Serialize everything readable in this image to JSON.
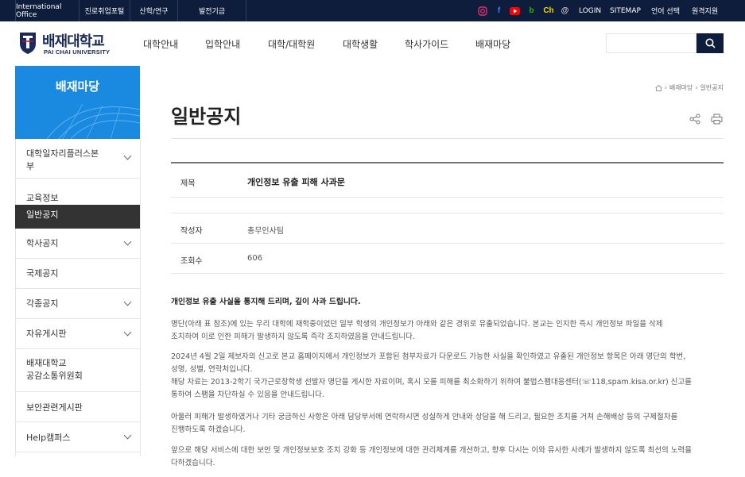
{
  "topbar": {
    "left_links": [
      "International Office",
      "진로취업포털",
      "산학/연구",
      "발전기금"
    ],
    "right_links": [
      "LOGIN",
      "SITEMAP",
      "언어 선택",
      "원격지원"
    ],
    "social": [
      {
        "name": "instagram-icon",
        "color": "#e1306c"
      },
      {
        "name": "facebook-icon",
        "glyph": "f",
        "color": "#3b82f6"
      },
      {
        "name": "youtube-icon",
        "color": "#ff0000"
      },
      {
        "name": "blog-icon",
        "glyph": "b",
        "color": "#2db400"
      },
      {
        "name": "channel-icon",
        "glyph": "Ch",
        "color": "#f2d600"
      },
      {
        "name": "threads-icon",
        "glyph": "@",
        "color": "#cccccc"
      }
    ]
  },
  "header": {
    "logo_kr": "배재대학교",
    "logo_en": "PAI CHAI UNIVERSITY",
    "nav": [
      "대학안내",
      "입학안내",
      "대학/대학원",
      "대학생활",
      "학사가이드",
      "배재마당"
    ],
    "search_placeholder": ""
  },
  "sidebar": {
    "title": "배재마당",
    "items": [
      {
        "label_lines": [
          "대학일자리플러스본",
          "부"
        ],
        "chevron": true
      },
      {
        "label_lines": [
          "교육정보"
        ],
        "chevron": false
      },
      {
        "label_lines": [
          "일반공지"
        ],
        "active": true
      },
      {
        "label_lines": [
          "학사공지"
        ],
        "chevron": true
      },
      {
        "label_lines": [
          "국제공지"
        ],
        "chevron": false
      },
      {
        "label_lines": [
          "각종공지"
        ],
        "chevron": true
      },
      {
        "label_lines": [
          "자유게시판"
        ],
        "chevron": true
      },
      {
        "label_lines": [
          "배재대학교",
          "공감소통위원회"
        ],
        "chevron": false
      },
      {
        "label_lines": [
          "보안관련게시판"
        ],
        "chevron": false
      },
      {
        "label_lines": [
          "Help캠퍼스"
        ],
        "chevron": true
      }
    ]
  },
  "breadcrumb": [
    "배재마당",
    "일반공지"
  ],
  "page_title": "일반공지",
  "post": {
    "title_label": "제목",
    "title": "개인정보 유출 피해 사과문",
    "author_label": "작성자",
    "author": "총무인사팀",
    "views_label": "조회수",
    "views": "606"
  },
  "body": {
    "lead": "개인정보 유출 사실을 통지해 드리며, 깊이 사과 드립니다.",
    "p1": [
      "명단(아래 표 참조)에 있는 우리 대학에 재학중이었던 일부 학생의 개인정보가 아래와 같은 경위로 유출되었습니다. 본교는 인지한 즉시 개인정보 파일을 삭제",
      "조치하여 이로 인한 피해가 발생하지 않도록 즉각 조치하였음을 안내드립니다."
    ],
    "p2": [
      "2024년 4월 2일 제보자의 신고로 본교 홈페이지에서 개인정보가 포함된 첨부자료가 다운로드 가능한 사실을 확인하였고 유출된 개인정보 항목은 아래 명단의 학번,",
      "성명, 성별, 연락처입니다.",
      "해당 자료는 2013-2학기 국가근로장학생 선발자 명단을 게시한 자료이며, 혹시 모를 피해를 최소화하기 위하여 불법스팸대응센터(☏118,spam.kisa.or.kr) 신고를",
      "통하여 스팸을 차단하실 수 있음을 안내드립니다."
    ],
    "p3": [
      "아울러 피해가 발생하였거나 기타 궁금하신 사항은 아래 담당부서에 연락하시면 성실하게 안내와 상담을 해 드리고, 필요한 조치를 거쳐 손해배상 등의 구제절차를",
      "진행하도록 하겠습니다."
    ],
    "p4": [
      "앞으로 해당 서비스에 대한 보안 및 개인정보보호 조치 강화 등 개인정보에 대한 관리체계를 개선하고, 향후 다시는 이와 유사한 사례가 발생하지 않도록 최선의 노력을",
      "다하겠습니다."
    ]
  }
}
